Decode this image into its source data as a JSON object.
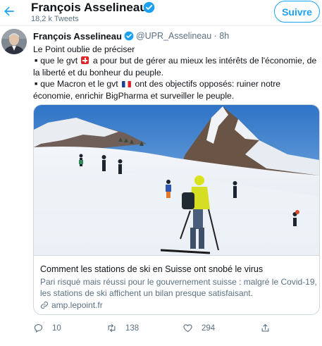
{
  "header": {
    "name": "François Asselineau",
    "tweet_count": "18,2 k Tweets",
    "follow_label": "Suivre"
  },
  "tweet": {
    "author_name": "François Asselineau",
    "handle_time": "@UPR_Asselineau · 8h",
    "line1": "Le Point oublie de préciser",
    "line2a": "que le gvt",
    "line2b": "a pour but de gérer au mieux les intérêts de l'économie, de",
    "line3": "la liberté et du bonheur du peuple.",
    "line4a": "que Macron et le gvt",
    "line4b": "ont des objectifs opposés: ruiner notre",
    "line5": "économie, enrichir BigPharma et surveiller le peuple.",
    "bullet": "■"
  },
  "card": {
    "title": "Comment les stations de ski en Suisse ont snobé le virus",
    "description": "Pari risqué mais réussi pour le gouvernement suisse : malgré le Covid-19, les stations de ski affichent un bilan presque satisfaisant.",
    "link": "amp.lepoint.fr"
  },
  "actions": {
    "replies": "10",
    "retweets": "138",
    "likes": "294"
  },
  "colors": {
    "accent": "#1da1f2",
    "secondary_text": "#5b7083",
    "border": "#cfd9de"
  },
  "icons": [
    "back-arrow-icon",
    "verified-badge-icon",
    "swiss-flag-icon",
    "french-flag-icon",
    "link-icon",
    "reply-icon",
    "retweet-icon",
    "like-icon",
    "share-icon"
  ]
}
